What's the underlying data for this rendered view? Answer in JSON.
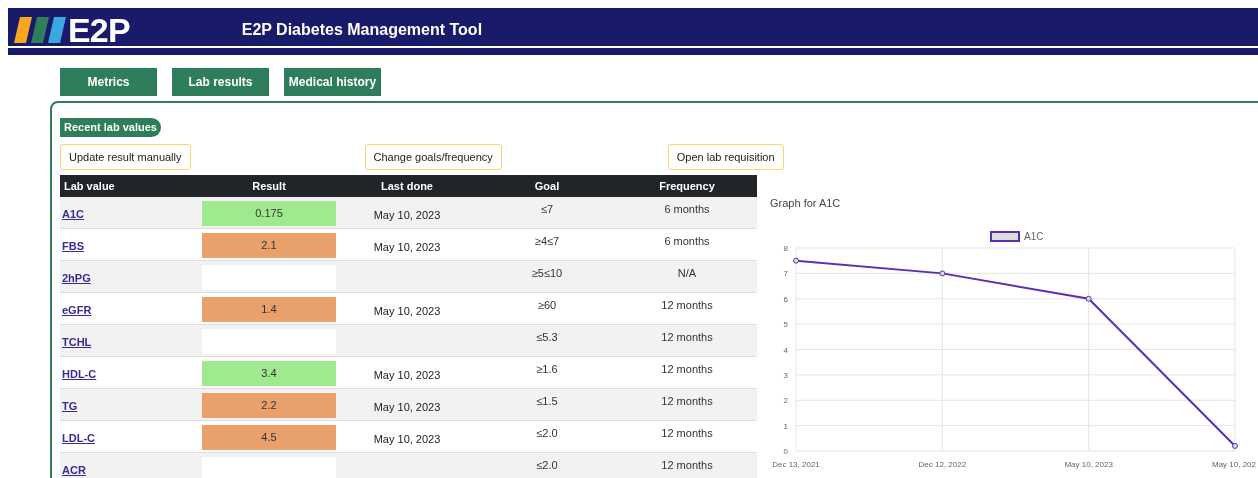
{
  "header": {
    "logo": "E2P",
    "title": "E2P Diabetes Management Tool"
  },
  "tabs": [
    {
      "label": "Metrics"
    },
    {
      "label": "Lab results"
    },
    {
      "label": "Medical history"
    }
  ],
  "section_label": "Recent lab values",
  "actions": [
    "Update result manually",
    "Change goals/frequency",
    "Open lab requisition"
  ],
  "table": {
    "columns": [
      "Lab value",
      "Result",
      "Last done",
      "Goal",
      "Frequency"
    ],
    "rows": [
      {
        "lab": "A1C",
        "result": "0.175",
        "color": "#9fe98f",
        "last_done": "May 10, 2023",
        "goal": "≤7",
        "frequency": "6 months"
      },
      {
        "lab": "FBS",
        "result": "2.1",
        "color": "#e9a06b",
        "last_done": "May 10, 2023",
        "goal": "≥4≤7",
        "frequency": "6 months"
      },
      {
        "lab": "2hPG",
        "color": "#ffffff",
        "goal": "≥5≤10",
        "frequency": "N/A"
      },
      {
        "lab": "eGFR",
        "result": "1.4",
        "color": "#e9a06b",
        "last_done": "May 10, 2023",
        "goal": "≥60",
        "frequency": "12 months"
      },
      {
        "lab": "TCHL",
        "color": "#ffffff",
        "goal": "≤5.3",
        "frequency": "12 months"
      },
      {
        "lab": "HDL-C",
        "result": "3.4",
        "color": "#9fe98f",
        "last_done": "May 10, 2023",
        "goal": "≥1.6",
        "frequency": "12 months"
      },
      {
        "lab": "TG",
        "result": "2.2",
        "color": "#e9a06b",
        "last_done": "May 10, 2023",
        "goal": "≤1.5",
        "frequency": "12 months"
      },
      {
        "lab": "LDL-C",
        "result": "4.5",
        "color": "#e9a06b",
        "last_done": "May 10, 2023",
        "goal": "≤2.0",
        "frequency": "12 months"
      },
      {
        "lab": "ACR",
        "color": "#ffffff",
        "goal": "≤2.0",
        "frequency": "12 months"
      }
    ]
  },
  "graph": {
    "title": "Graph for A1C",
    "chart_data": {
      "type": "line",
      "categories": [
        "Dec 13, 2021",
        "Dec 12, 2022",
        "May 10, 2023",
        "May 10, 202"
      ],
      "series": [
        {
          "name": "A1C",
          "color": "#5b2fb5",
          "marker": "circle",
          "values": [
            7.5,
            7,
            6,
            0.2
          ]
        }
      ],
      "grid": true,
      "ylim": [
        0,
        8
      ],
      "yticks": [
        0,
        1,
        2,
        3,
        4,
        5,
        6,
        7,
        8
      ]
    }
  }
}
